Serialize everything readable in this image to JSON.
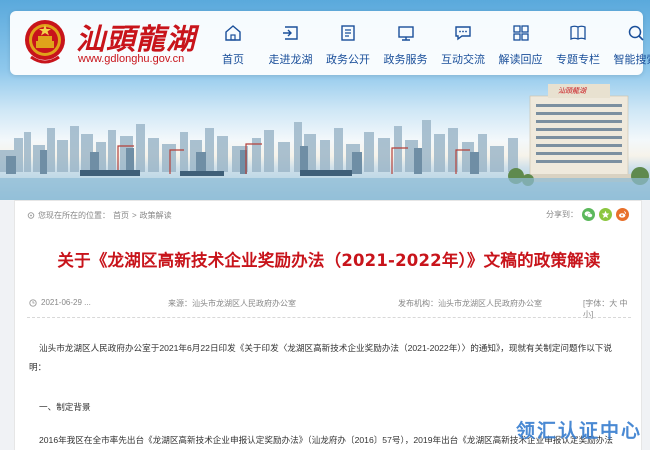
{
  "header": {
    "logo_text": "汕頭龍湖",
    "site_url": "www.gdlonghu.gov.cn",
    "nav": [
      {
        "label": "首页",
        "icon": "home-icon"
      },
      {
        "label": "走进龙湖",
        "icon": "enter-icon"
      },
      {
        "label": "政务公开",
        "icon": "document-icon"
      },
      {
        "label": "政务服务",
        "icon": "monitor-icon"
      },
      {
        "label": "互动交流",
        "icon": "chat-icon"
      },
      {
        "label": "解读回应",
        "icon": "grid-icon"
      },
      {
        "label": "专题专栏",
        "icon": "book-icon"
      },
      {
        "label": "智能搜索",
        "icon": "search-icon"
      }
    ]
  },
  "banner": {
    "building_sign": "汕頭龍湖"
  },
  "breadcrumb": {
    "prefix": "您现在所在的位置：",
    "home": "首页",
    "sep": ">",
    "current": "政策解读"
  },
  "share": {
    "label": "分享到：",
    "targets": [
      "wechat-icon",
      "qzone-icon",
      "weibo-icon"
    ]
  },
  "article": {
    "title": "关于《龙湖区高新技术企业奖励办法（2021-2022年）》文稿的政策解读",
    "date": "2021-06-29 ...",
    "source": "来源：汕头市龙湖区人民政府办公室",
    "publisher": "发布机构：汕头市龙湖区人民政府办公室",
    "font_size": "[字体：大 中 小]",
    "para1_line1": "汕头市龙湖区人民政府办公室于2021年6月22日印发《关于印发〈龙湖区高新技术企业奖励办法（2021-2022年）〉的通知》，现就有关制定问题作以下说",
    "para1_line2": "明：",
    "section1": "一、制定背景",
    "para2": "2016年我区在全市率先出台《龙湖区高新技术企业申报认定奖励办法》（汕龙府办〔2016〕57号），2019年出台《龙湖区高新技术企业申报认定奖励办法"
  },
  "watermark": "领汇认证中心",
  "colors": {
    "brand_red": "#c8141b",
    "nav_blue": "#1a4f9a",
    "share_green": "#5cb85c",
    "share_orange": "#e8702a",
    "watermark_blue": "#3a7fd0"
  }
}
